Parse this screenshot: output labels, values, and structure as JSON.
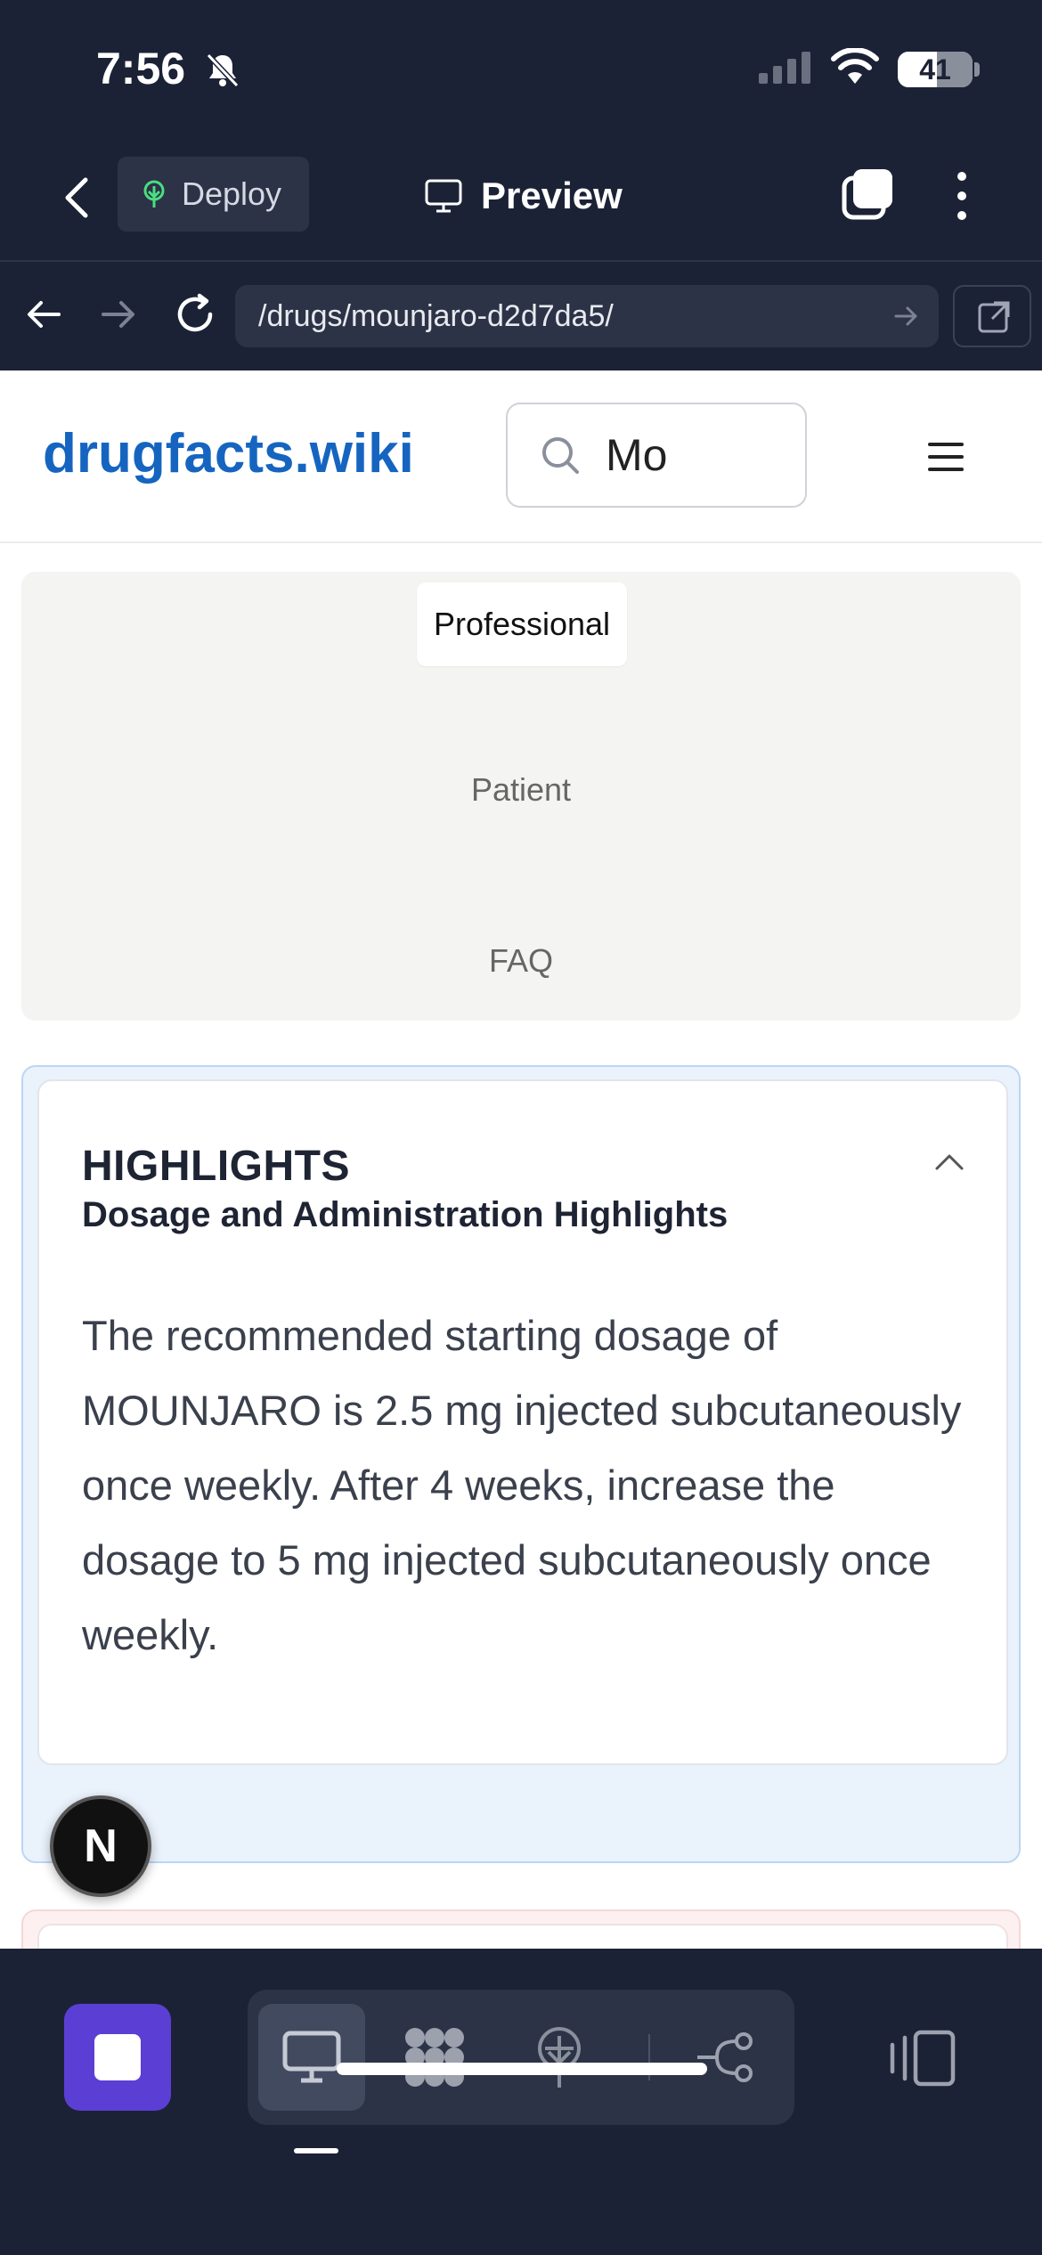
{
  "status_bar": {
    "time": "7:56",
    "battery": "41"
  },
  "toolbar": {
    "deploy_label": "Deploy",
    "preview_label": "Preview"
  },
  "url_bar": {
    "url": "/drugs/mounjaro-d2d7da5/"
  },
  "site": {
    "brand": "drugfacts.wiki",
    "search_value": "Mo"
  },
  "view_tabs": [
    {
      "label": "Professional",
      "active": true
    },
    {
      "label": "Patient",
      "active": false
    },
    {
      "label": "FAQ",
      "active": false
    }
  ],
  "highlights": {
    "title": "HIGHLIGHTS",
    "subtitle": "Dosage and Administration Highlights",
    "body": "The recommended starting dosage of MOUNJARO is 2.5 mg injected subcutaneously once weekly. After 4 weeks, increase the dosage to 5 mg injected subcutaneously once weekly."
  },
  "dev_badge": "N",
  "colors": {
    "chrome_bg": "#1c2236",
    "brand_blue": "#1565c0",
    "stop_purple": "#5b3fd4",
    "deploy_icon_green": "#4ade80"
  },
  "icons": [
    "bell-off-icon",
    "signal-icon",
    "wifi-icon",
    "battery-icon",
    "back-chevron-icon",
    "deploy-tree-icon",
    "monitor-icon",
    "tabs-icon",
    "more-vertical-icon",
    "arrow-left-icon",
    "arrow-right-icon",
    "reload-icon",
    "external-link-icon",
    "search-icon",
    "hamburger-icon",
    "chevron-up-icon",
    "stop-icon",
    "grid-icon",
    "deploy-icon",
    "flow-icon",
    "panel-icon"
  ]
}
